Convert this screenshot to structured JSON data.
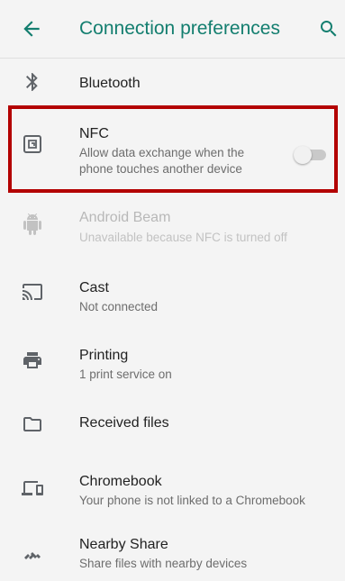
{
  "header": {
    "title": "Connection preferences",
    "back_icon": "arrow-back-icon",
    "search_icon": "search-icon"
  },
  "colors": {
    "accent": "#137e6f",
    "highlight_border": "#b30000",
    "icon": "#5f6368",
    "disabled": "#b8b8b8"
  },
  "items": [
    {
      "label": "Bluetooth",
      "sub": "",
      "icon": "bluetooth-icon"
    },
    {
      "label": "NFC",
      "sub": "Allow data exchange when the phone touches another device",
      "icon": "nfc-icon",
      "toggle_on": false
    },
    {
      "label": "Android Beam",
      "sub": "Unavailable because NFC is turned off",
      "icon": "android-icon",
      "disabled": true
    },
    {
      "label": "Cast",
      "sub": "Not connected",
      "icon": "cast-icon"
    },
    {
      "label": "Printing",
      "sub": "1 print service on",
      "icon": "printer-icon"
    },
    {
      "label": "Received files",
      "sub": "",
      "icon": "folder-icon"
    },
    {
      "label": "Chromebook",
      "sub": "Your phone is not linked to a Chromebook",
      "icon": "chromebook-icon"
    },
    {
      "label": "Nearby Share",
      "sub": "Share files with nearby devices",
      "icon": "nearby-share-icon"
    }
  ]
}
